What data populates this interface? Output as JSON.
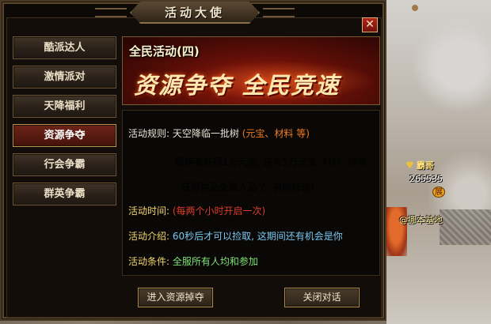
{
  "window": {
    "title": "活动大使",
    "close_label": "✕"
  },
  "sidebar": {
    "items": [
      {
        "label": "酷派达人"
      },
      {
        "label": "激情派对"
      },
      {
        "label": "天降福利"
      },
      {
        "label": "资源争夺",
        "active": true
      },
      {
        "label": "行会争霸"
      },
      {
        "label": "群英争霸"
      }
    ]
  },
  "banner": {
    "subtitle": "全民活动(四)",
    "headline": "资源争夺 全民竞速"
  },
  "details": {
    "rule_label": "活动规则:",
    "rule_line1_text": "天空降临一批树",
    "rule_line1_highlight": "(元宝、材料 等)",
    "rule_line2": "砸碎者获得1万元宝, 还有5万元宝, 材料, 掉落",
    "rule_line3": ", 获得物品全靠人品了, 祝你好运!",
    "time_label": "活动时间:",
    "time_value": "(每两个小时开启一次)",
    "intro_label": "活动介绍:",
    "intro_value": "60秒后才可以捡取, 这期间还有机会是你",
    "condition_label": "活动条件:",
    "condition_value": "全服所有人均和参加"
  },
  "buttons": {
    "enter": "进入资源掉夺",
    "close": "关闭对话"
  },
  "scene": {
    "player_title": "霸哥",
    "player_level": "265535",
    "player_badge": "展",
    "player_name": "@挪本基地"
  }
}
